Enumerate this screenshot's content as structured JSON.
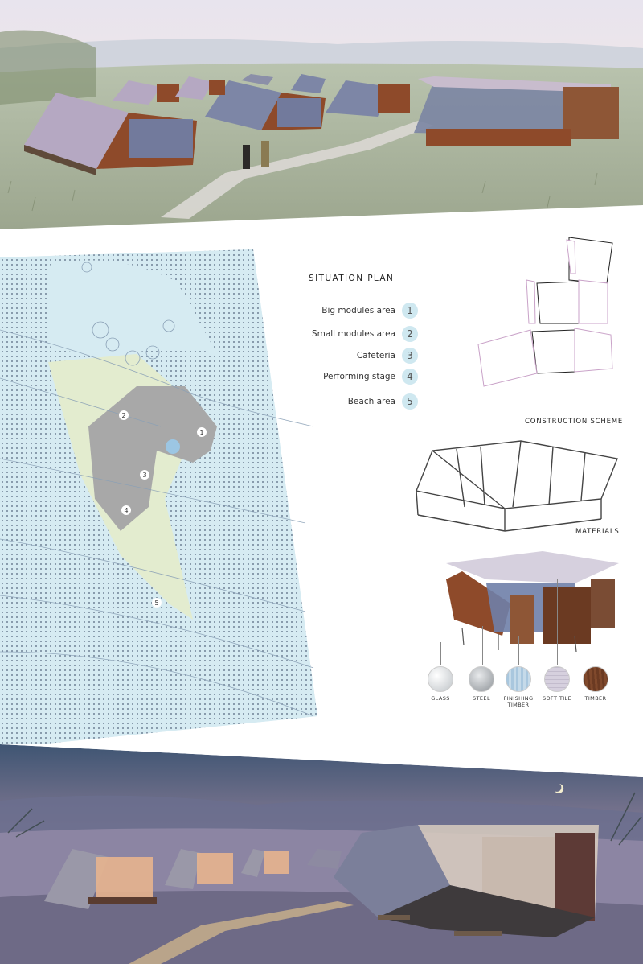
{
  "situation_plan": {
    "title": "SITUATION PLAN",
    "legend": [
      {
        "label": "Big modules area",
        "number": "1"
      },
      {
        "label": "Small modules area",
        "number": "2"
      },
      {
        "label": "Cafeteria",
        "number": "3"
      },
      {
        "label": "Performing stage",
        "number": "4"
      },
      {
        "label": "Beach area",
        "number": "5"
      }
    ],
    "map_markers": [
      "1",
      "2",
      "3",
      "4",
      "5"
    ]
  },
  "construction": {
    "title": "CONSTRUCTION SCHEME"
  },
  "materials": {
    "title": "MATERIALS",
    "items": [
      {
        "label": "GLASS",
        "color": "#d9dde0"
      },
      {
        "label": "STEEL",
        "color": "#a9adb1"
      },
      {
        "label": "FINISHING TIMBER",
        "color": "#a9c7de"
      },
      {
        "label": "SOFT TILE",
        "color": "#d6d0de"
      },
      {
        "label": "TIMBER",
        "color": "#6b3a22"
      }
    ]
  },
  "colors": {
    "accent_blue": "#cfe8f0",
    "plan_green": "#e3eccf",
    "plan_water": "#d6ebf2",
    "module_pink": "#c9a2c8"
  }
}
